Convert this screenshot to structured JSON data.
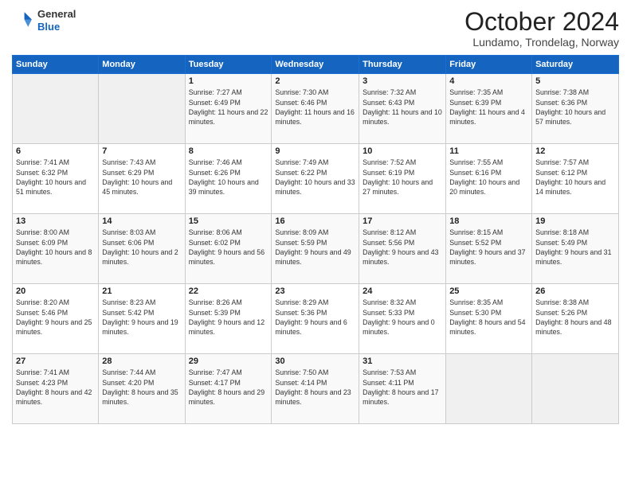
{
  "header": {
    "logo_line1": "General",
    "logo_line2": "Blue",
    "month": "October 2024",
    "location": "Lundamo, Trondelag, Norway"
  },
  "weekdays": [
    "Sunday",
    "Monday",
    "Tuesday",
    "Wednesday",
    "Thursday",
    "Friday",
    "Saturday"
  ],
  "weeks": [
    [
      {
        "day": "",
        "sunrise": "",
        "sunset": "",
        "daylight": ""
      },
      {
        "day": "",
        "sunrise": "",
        "sunset": "",
        "daylight": ""
      },
      {
        "day": "1",
        "sunrise": "Sunrise: 7:27 AM",
        "sunset": "Sunset: 6:49 PM",
        "daylight": "Daylight: 11 hours and 22 minutes."
      },
      {
        "day": "2",
        "sunrise": "Sunrise: 7:30 AM",
        "sunset": "Sunset: 6:46 PM",
        "daylight": "Daylight: 11 hours and 16 minutes."
      },
      {
        "day": "3",
        "sunrise": "Sunrise: 7:32 AM",
        "sunset": "Sunset: 6:43 PM",
        "daylight": "Daylight: 11 hours and 10 minutes."
      },
      {
        "day": "4",
        "sunrise": "Sunrise: 7:35 AM",
        "sunset": "Sunset: 6:39 PM",
        "daylight": "Daylight: 11 hours and 4 minutes."
      },
      {
        "day": "5",
        "sunrise": "Sunrise: 7:38 AM",
        "sunset": "Sunset: 6:36 PM",
        "daylight": "Daylight: 10 hours and 57 minutes."
      }
    ],
    [
      {
        "day": "6",
        "sunrise": "Sunrise: 7:41 AM",
        "sunset": "Sunset: 6:32 PM",
        "daylight": "Daylight: 10 hours and 51 minutes."
      },
      {
        "day": "7",
        "sunrise": "Sunrise: 7:43 AM",
        "sunset": "Sunset: 6:29 PM",
        "daylight": "Daylight: 10 hours and 45 minutes."
      },
      {
        "day": "8",
        "sunrise": "Sunrise: 7:46 AM",
        "sunset": "Sunset: 6:26 PM",
        "daylight": "Daylight: 10 hours and 39 minutes."
      },
      {
        "day": "9",
        "sunrise": "Sunrise: 7:49 AM",
        "sunset": "Sunset: 6:22 PM",
        "daylight": "Daylight: 10 hours and 33 minutes."
      },
      {
        "day": "10",
        "sunrise": "Sunrise: 7:52 AM",
        "sunset": "Sunset: 6:19 PM",
        "daylight": "Daylight: 10 hours and 27 minutes."
      },
      {
        "day": "11",
        "sunrise": "Sunrise: 7:55 AM",
        "sunset": "Sunset: 6:16 PM",
        "daylight": "Daylight: 10 hours and 20 minutes."
      },
      {
        "day": "12",
        "sunrise": "Sunrise: 7:57 AM",
        "sunset": "Sunset: 6:12 PM",
        "daylight": "Daylight: 10 hours and 14 minutes."
      }
    ],
    [
      {
        "day": "13",
        "sunrise": "Sunrise: 8:00 AM",
        "sunset": "Sunset: 6:09 PM",
        "daylight": "Daylight: 10 hours and 8 minutes."
      },
      {
        "day": "14",
        "sunrise": "Sunrise: 8:03 AM",
        "sunset": "Sunset: 6:06 PM",
        "daylight": "Daylight: 10 hours and 2 minutes."
      },
      {
        "day": "15",
        "sunrise": "Sunrise: 8:06 AM",
        "sunset": "Sunset: 6:02 PM",
        "daylight": "Daylight: 9 hours and 56 minutes."
      },
      {
        "day": "16",
        "sunrise": "Sunrise: 8:09 AM",
        "sunset": "Sunset: 5:59 PM",
        "daylight": "Daylight: 9 hours and 49 minutes."
      },
      {
        "day": "17",
        "sunrise": "Sunrise: 8:12 AM",
        "sunset": "Sunset: 5:56 PM",
        "daylight": "Daylight: 9 hours and 43 minutes."
      },
      {
        "day": "18",
        "sunrise": "Sunrise: 8:15 AM",
        "sunset": "Sunset: 5:52 PM",
        "daylight": "Daylight: 9 hours and 37 minutes."
      },
      {
        "day": "19",
        "sunrise": "Sunrise: 8:18 AM",
        "sunset": "Sunset: 5:49 PM",
        "daylight": "Daylight: 9 hours and 31 minutes."
      }
    ],
    [
      {
        "day": "20",
        "sunrise": "Sunrise: 8:20 AM",
        "sunset": "Sunset: 5:46 PM",
        "daylight": "Daylight: 9 hours and 25 minutes."
      },
      {
        "day": "21",
        "sunrise": "Sunrise: 8:23 AM",
        "sunset": "Sunset: 5:42 PM",
        "daylight": "Daylight: 9 hours and 19 minutes."
      },
      {
        "day": "22",
        "sunrise": "Sunrise: 8:26 AM",
        "sunset": "Sunset: 5:39 PM",
        "daylight": "Daylight: 9 hours and 12 minutes."
      },
      {
        "day": "23",
        "sunrise": "Sunrise: 8:29 AM",
        "sunset": "Sunset: 5:36 PM",
        "daylight": "Daylight: 9 hours and 6 minutes."
      },
      {
        "day": "24",
        "sunrise": "Sunrise: 8:32 AM",
        "sunset": "Sunset: 5:33 PM",
        "daylight": "Daylight: 9 hours and 0 minutes."
      },
      {
        "day": "25",
        "sunrise": "Sunrise: 8:35 AM",
        "sunset": "Sunset: 5:30 PM",
        "daylight": "Daylight: 8 hours and 54 minutes."
      },
      {
        "day": "26",
        "sunrise": "Sunrise: 8:38 AM",
        "sunset": "Sunset: 5:26 PM",
        "daylight": "Daylight: 8 hours and 48 minutes."
      }
    ],
    [
      {
        "day": "27",
        "sunrise": "Sunrise: 7:41 AM",
        "sunset": "Sunset: 4:23 PM",
        "daylight": "Daylight: 8 hours and 42 minutes."
      },
      {
        "day": "28",
        "sunrise": "Sunrise: 7:44 AM",
        "sunset": "Sunset: 4:20 PM",
        "daylight": "Daylight: 8 hours and 35 minutes."
      },
      {
        "day": "29",
        "sunrise": "Sunrise: 7:47 AM",
        "sunset": "Sunset: 4:17 PM",
        "daylight": "Daylight: 8 hours and 29 minutes."
      },
      {
        "day": "30",
        "sunrise": "Sunrise: 7:50 AM",
        "sunset": "Sunset: 4:14 PM",
        "daylight": "Daylight: 8 hours and 23 minutes."
      },
      {
        "day": "31",
        "sunrise": "Sunrise: 7:53 AM",
        "sunset": "Sunset: 4:11 PM",
        "daylight": "Daylight: 8 hours and 17 minutes."
      },
      {
        "day": "",
        "sunrise": "",
        "sunset": "",
        "daylight": ""
      },
      {
        "day": "",
        "sunrise": "",
        "sunset": "",
        "daylight": ""
      }
    ]
  ]
}
